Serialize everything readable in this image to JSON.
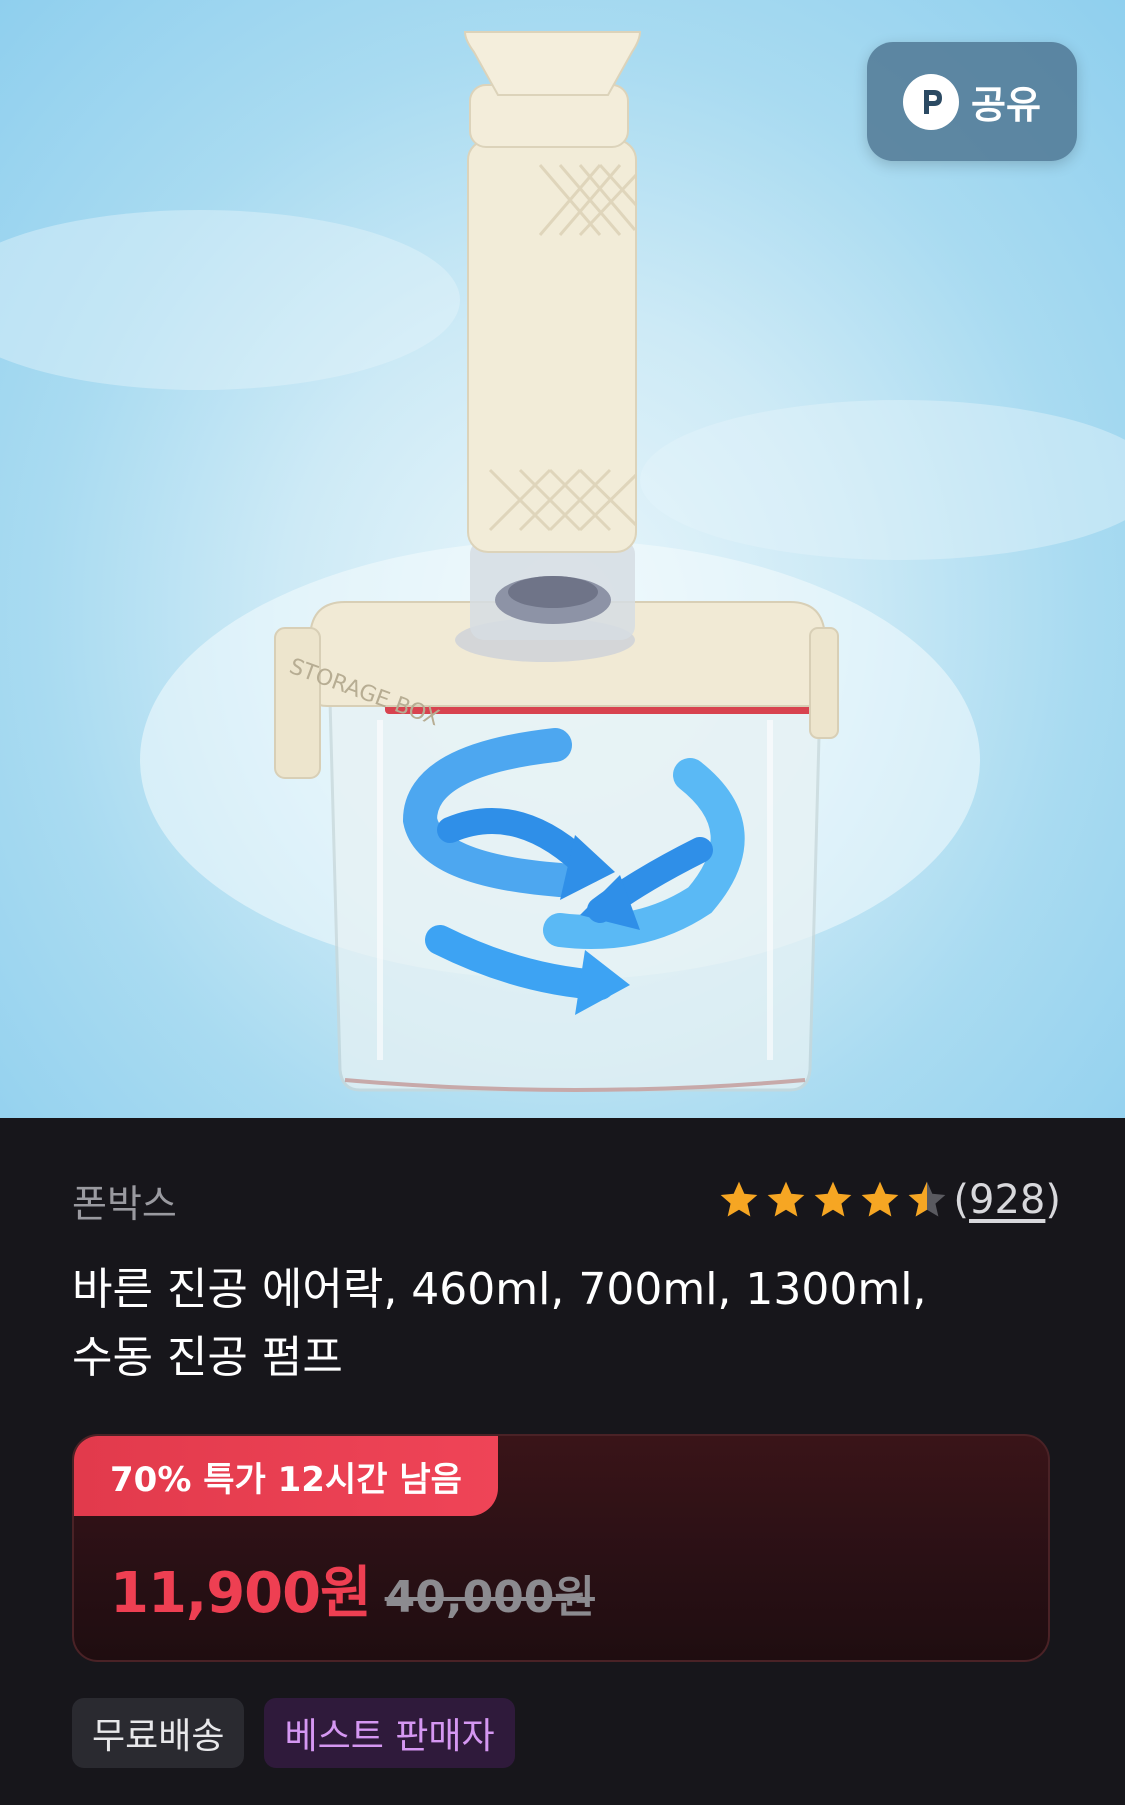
{
  "share": {
    "label": "공유",
    "icon": "p-logo-icon"
  },
  "product": {
    "brand": "폰박스",
    "rating": 4.5,
    "review_count": "(928)",
    "review_count_inner": "928",
    "title_line1": "바른 진공 에어락, 460ml, 700ml, 1300ml,",
    "title_line2": "수동 진공 펌프",
    "container_print": "STORAGE BOX"
  },
  "deal": {
    "tag": "70% 특가 12시간 남음",
    "price": "11,900원",
    "original_price": "40,000원"
  },
  "badges": [
    {
      "label": "무료배송"
    },
    {
      "label": "베스트 판매자"
    }
  ],
  "colors": {
    "accent_red": "#ee3f52",
    "star": "#f6a623",
    "best_seller_text": "#d597f2"
  }
}
